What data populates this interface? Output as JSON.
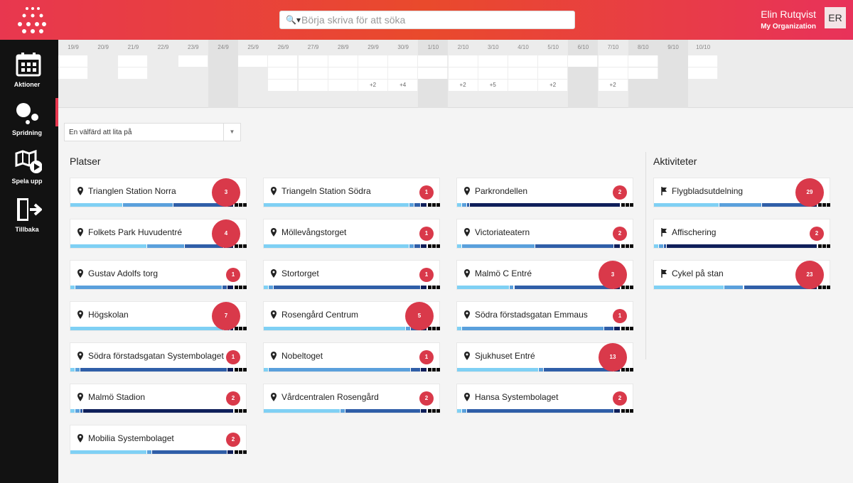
{
  "search": {
    "placeholder": "Börja skriva för att söka"
  },
  "user": {
    "name": "Elin Rutqvist",
    "org": "My Organization",
    "initials": "ER"
  },
  "nav": [
    {
      "label": "Aktioner",
      "icon": "calendar-icon"
    },
    {
      "label": "Spridning",
      "icon": "bubbles-icon"
    },
    {
      "label": "Spela upp",
      "icon": "map-play-icon"
    },
    {
      "label": "Tillbaka",
      "icon": "exit-door-icon"
    }
  ],
  "timeline": {
    "dates": [
      "19/9",
      "20/9",
      "21/9",
      "22/9",
      "23/9",
      "24/9",
      "25/9",
      "26/9",
      "27/9",
      "28/9",
      "29/9",
      "30/9",
      "1/10",
      "2/10",
      "3/10",
      "4/10",
      "5/10",
      "6/10",
      "7/10",
      "8/10",
      "9/10",
      "10/10"
    ],
    "more": {
      "10": "+2",
      "11": "+4",
      "13": "+2",
      "14": "+5",
      "16": "+2",
      "18": "+2"
    }
  },
  "filter": {
    "value": "En välfärd att lita på"
  },
  "places": {
    "title": "Platser"
  },
  "activities": {
    "title": "Aktiviteter"
  },
  "colors": {
    "c1": "#7fd0f4",
    "c2": "#5aa0dc",
    "c3": "#2f5ea8",
    "c4": "#0f1f5a",
    "badge": "#d9394a",
    "accent": "#e8374f"
  },
  "cards": [
    {
      "name": "Trianglen Station Norra",
      "count": "3",
      "big": true,
      "bar": [
        0.32,
        0.31,
        0.33,
        0.04
      ]
    },
    {
      "name": "Folkets Park Huvudentré",
      "count": "4",
      "big": true,
      "bar": [
        0.47,
        0.23,
        0.24,
        0.06
      ]
    },
    {
      "name": "Gustav Adolfs torg",
      "count": "1",
      "big": false,
      "bar": [
        0.03,
        0.9,
        0.03,
        0.04
      ]
    },
    {
      "name": "Högskolan",
      "count": "7",
      "big": true,
      "bar": [
        0.94,
        0.02,
        0.02,
        0.02
      ]
    },
    {
      "name": "Södra förstadsgatan Systembolaget",
      "count": "1",
      "big": false,
      "bar": [
        0.03,
        0.03,
        0.9,
        0.04
      ]
    },
    {
      "name": "Malmö Stadion",
      "count": "2",
      "big": false,
      "bar": [
        0.03,
        0.03,
        0.02,
        0.92
      ]
    },
    {
      "name": "Mobilia Systembolaget",
      "count": "2",
      "big": false,
      "bar": [
        0.47,
        0.03,
        0.46,
        0.04
      ]
    },
    {
      "name": "Triangeln Station Södra",
      "count": "1",
      "big": false,
      "bar": [
        0.89,
        0.03,
        0.04,
        0.04
      ]
    },
    {
      "name": "Möllevångstorget",
      "count": "1",
      "big": false,
      "bar": [
        0.89,
        0.03,
        0.04,
        0.04
      ]
    },
    {
      "name": "Stortorget",
      "count": "1",
      "big": false,
      "bar": [
        0.03,
        0.03,
        0.9,
        0.04
      ]
    },
    {
      "name": "Rosengård Centrum",
      "count": "5",
      "big": true,
      "bar": [
        0.87,
        0.03,
        0.06,
        0.04
      ]
    },
    {
      "name": "Nobeltoget",
      "count": "1",
      "big": false,
      "bar": [
        0.03,
        0.87,
        0.06,
        0.04
      ]
    },
    {
      "name": "Vårdcentralen Rosengård",
      "count": "2",
      "big": false,
      "bar": [
        0.47,
        0.03,
        0.46,
        0.04
      ]
    },
    {
      "name": "Parkrondellen",
      "count": "2",
      "big": false,
      "bar": [
        0.03,
        0.03,
        0.02,
        0.92
      ]
    },
    {
      "name": "Victoriateatern",
      "count": "2",
      "big": false,
      "bar": [
        0.03,
        0.45,
        0.48,
        0.04
      ]
    },
    {
      "name": "Malmö C Entré",
      "count": "3",
      "big": true,
      "bar": [
        0.32,
        0.03,
        0.61,
        0.04
      ]
    },
    {
      "name": "Södra förstadsgatan Emmaus",
      "count": "1",
      "big": false,
      "bar": [
        0.03,
        0.87,
        0.06,
        0.04
      ]
    },
    {
      "name": "Sjukhuset Entré",
      "count": "13",
      "big": true,
      "bar": [
        0.5,
        0.03,
        0.43,
        0.04
      ]
    },
    {
      "name": "Hansa Systembolaget",
      "count": "2",
      "big": false,
      "bar": [
        0.03,
        0.03,
        0.9,
        0.04
      ]
    }
  ],
  "acts": [
    {
      "name": "Flygbladsutdelning",
      "count": "29",
      "big": true,
      "bar": [
        0.4,
        0.26,
        0.3,
        0.04
      ]
    },
    {
      "name": "Affischering",
      "count": "2",
      "big": false,
      "bar": [
        0.03,
        0.03,
        0.02,
        0.92
      ]
    },
    {
      "name": "Cykel på stan",
      "count": "23",
      "big": true,
      "bar": [
        0.43,
        0.12,
        0.41,
        0.04
      ]
    }
  ]
}
